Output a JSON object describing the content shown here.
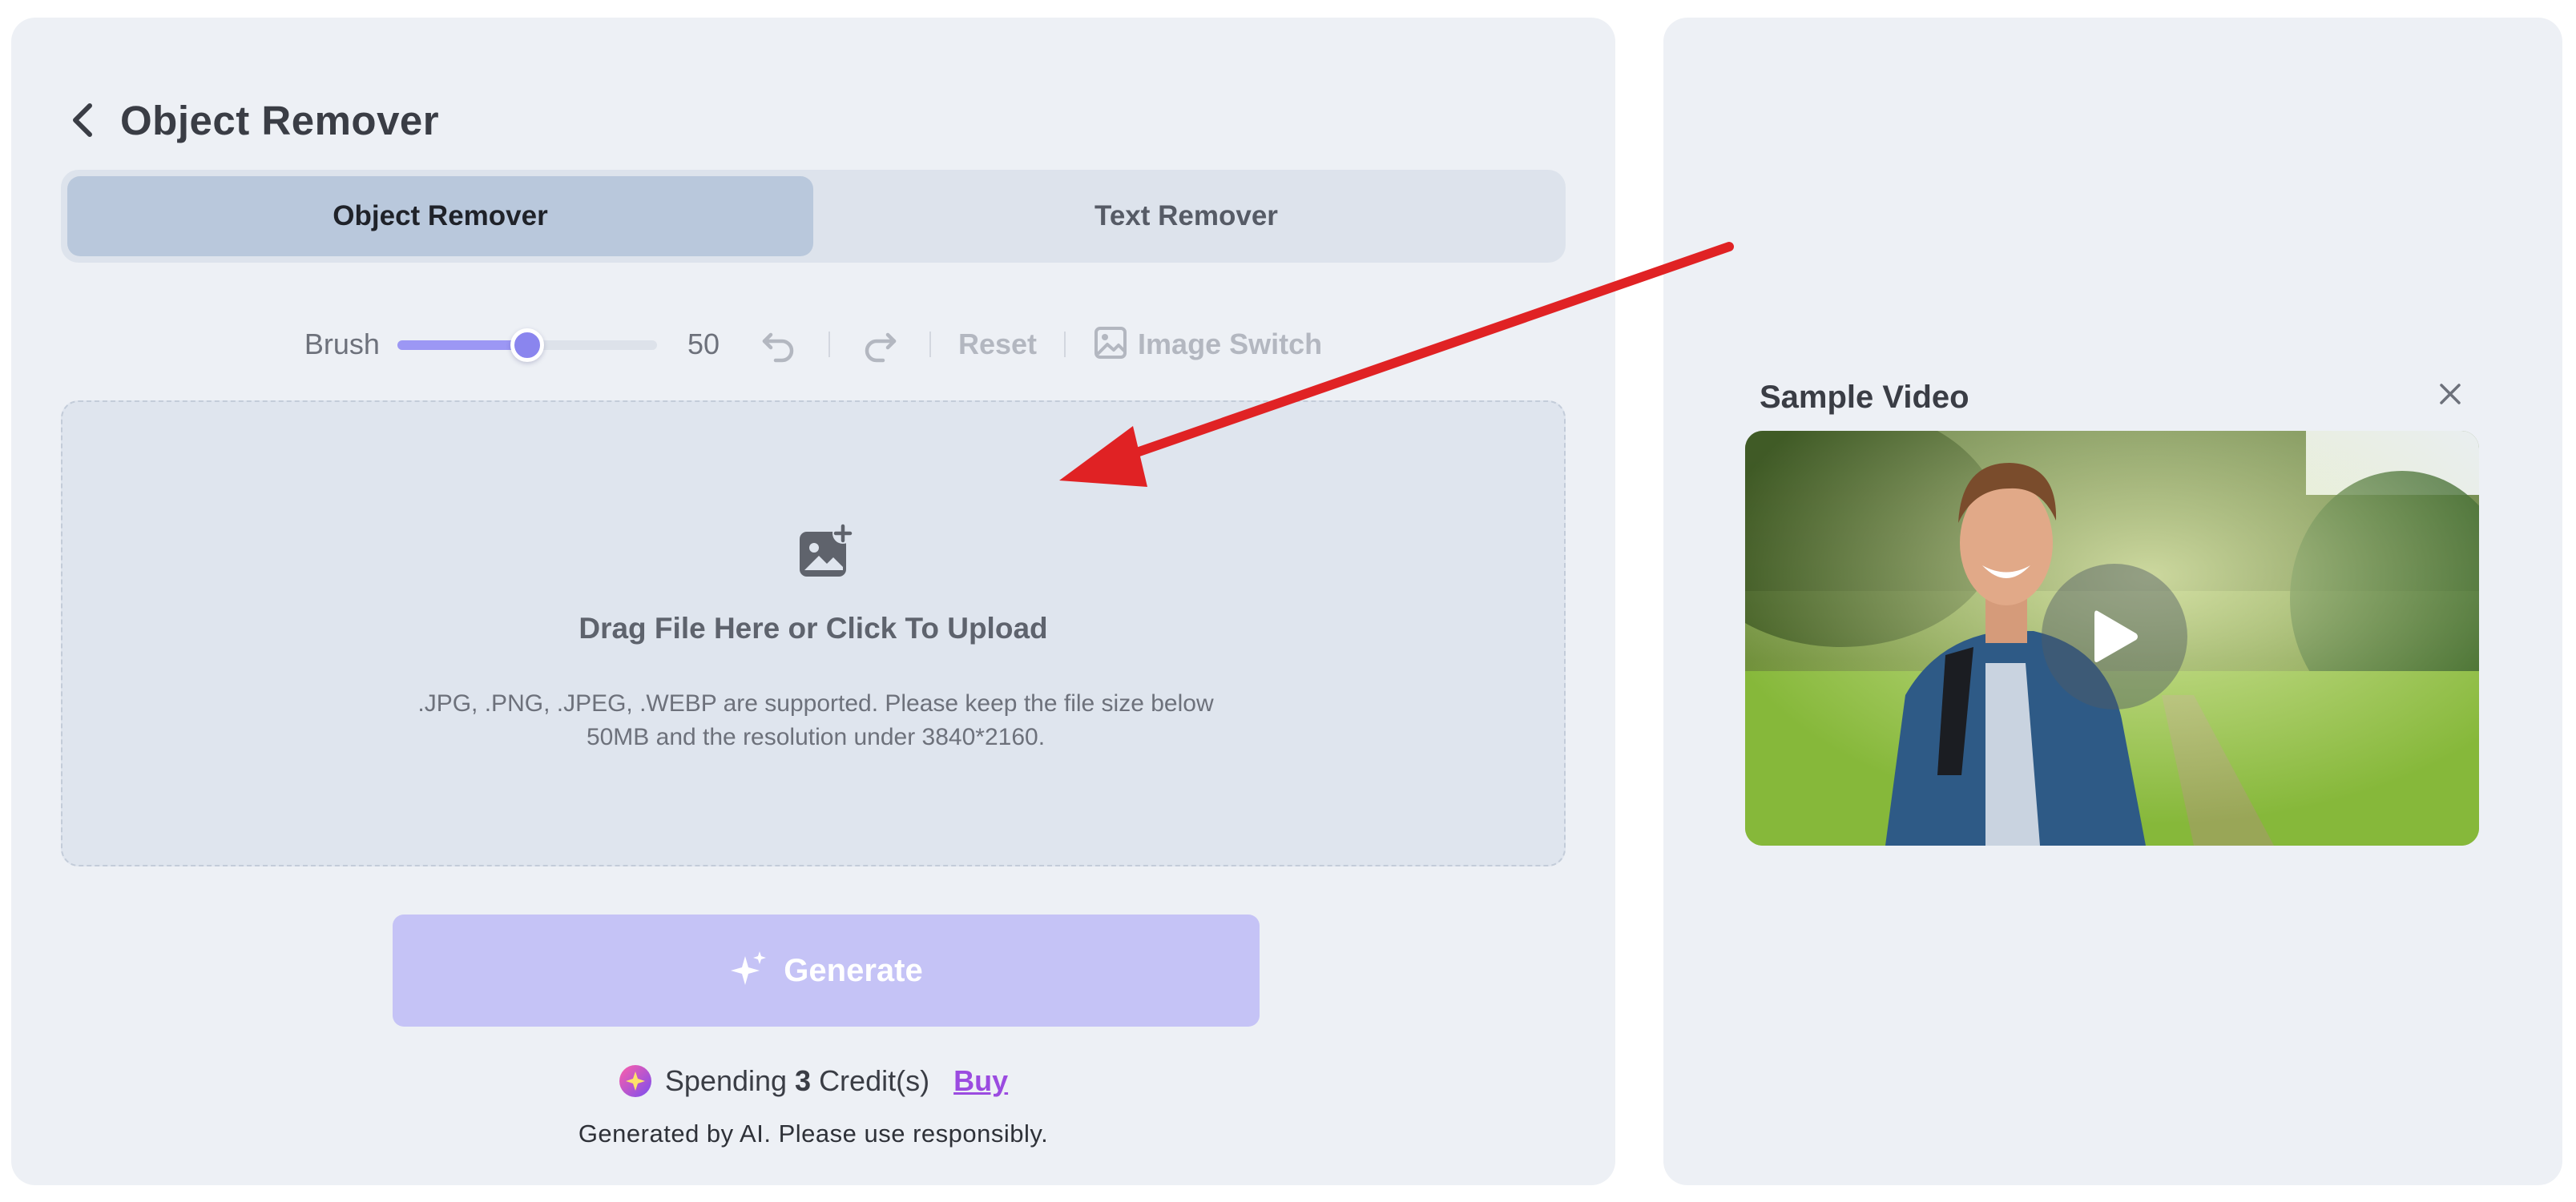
{
  "header": {
    "title": "Object Remover"
  },
  "tabs": [
    {
      "label": "Object Remover",
      "active": true
    },
    {
      "label": "Text Remover",
      "active": false
    }
  ],
  "toolbar": {
    "brush_label": "Brush",
    "brush_value": "50",
    "brush_max": 100,
    "reset_label": "Reset",
    "image_switch_label": "Image Switch"
  },
  "upload": {
    "icon": "add-image-icon",
    "title": "Drag File Here or Click To Upload",
    "hint": ".JPG, .PNG, .JPEG, .WEBP are supported. Please keep the file size below 50MB and the resolution under 3840*2160."
  },
  "generate": {
    "label": "Generate",
    "icon": "sparkle-icon"
  },
  "credits": {
    "prefix": "Spending",
    "count": "3",
    "suffix": "Credit(s)",
    "buy_label": "Buy"
  },
  "disclaimer": "Generated by AI. Please use responsibly.",
  "sample": {
    "title": "Sample Video",
    "close_icon": "close-icon",
    "play_icon": "play-icon"
  },
  "colors": {
    "panel_bg": "#edf0f5",
    "active_tab": "#b9c8dc",
    "accent": "#8a85ee",
    "generate_bg": "#c5c3f6",
    "buy_link": "#9b4be0",
    "annotation_arrow": "#e02224"
  }
}
